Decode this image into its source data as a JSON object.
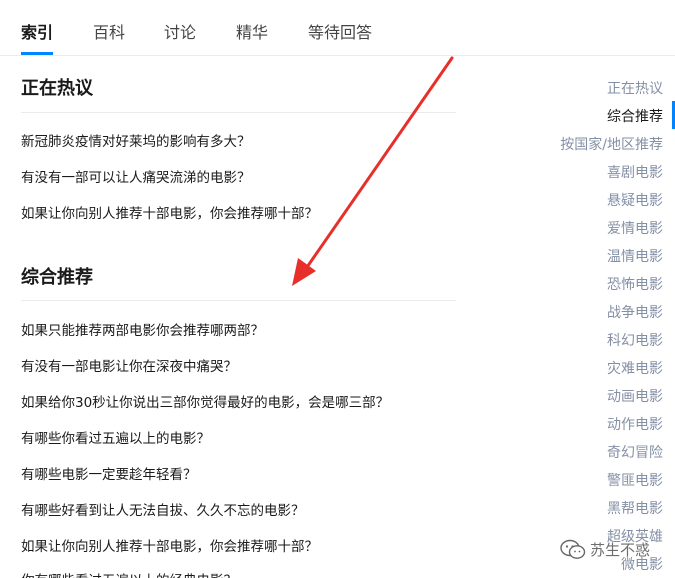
{
  "tabs": [
    {
      "label": "索引"
    },
    {
      "label": "百科"
    },
    {
      "label": "讨论"
    },
    {
      "label": "精华"
    },
    {
      "label": "等待回答"
    }
  ],
  "hot": {
    "title": "正在热议",
    "items": [
      "新冠肺炎疫情对好莱坞的影响有多大？",
      "有没有一部可以让人痛哭流涕的电影？",
      "如果让你向别人推荐十部电影，你会推荐哪十部？"
    ]
  },
  "recommend": {
    "title": "综合推荐",
    "items": [
      "如果只能推荐两部电影你会推荐哪两部？",
      "有没有一部电影让你在深夜中痛哭？",
      "如果给你30秒让你说出三部你觉得最好的电影，会是哪三部？",
      "有哪些你看过五遍以上的电影？",
      "有哪些电影一定要趁年轻看？",
      "有哪些好看到让人无法自拔、久久不忘的电影？",
      "如果让你向别人推荐十部电影，你会推荐哪十部？",
      "你有哪些看过五遍以上的经典电影？"
    ]
  },
  "sidenav": {
    "items": [
      "正在热议",
      "综合推荐",
      "按国家/地区推荐",
      "喜剧电影",
      "悬疑电影",
      "爱情电影",
      "温情电影",
      "恐怖电影",
      "战争电影",
      "科幻电影",
      "灾难电影",
      "动画电影",
      "动作电影",
      "奇幻冒险",
      "警匪电影",
      "黑帮电影",
      "超级英雄",
      "微电影"
    ],
    "active_index": 1
  },
  "watermark": {
    "text": "苏生不惑",
    "icon": "wechat-icon"
  },
  "colors": {
    "accent": "#0084ff",
    "arrow": "#e8302a",
    "muted": "#8590a6"
  }
}
